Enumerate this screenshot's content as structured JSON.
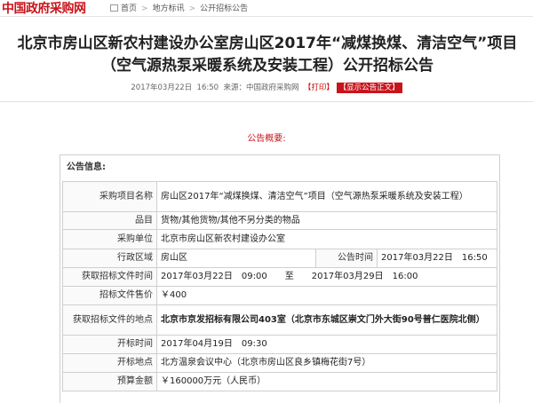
{
  "header": {
    "logo": "中国政府采购网",
    "breadcrumb": [
      "首页",
      "地方标讯",
      "公开招标公告"
    ]
  },
  "article": {
    "title": "北京市房山区新农村建设办公室房山区2017年“减煤换煤、清洁空气”项目（空气源热泵采暖系统及安装工程）公开招标公告",
    "date": "2017年03月22日",
    "time": "16:50",
    "source_label": "来源：",
    "source": "中国政府采购网",
    "print_label": "【打印】",
    "show_body_label": "【显示公告正文】"
  },
  "overview_title": "公告概要:",
  "info": {
    "heading": "公告信息:",
    "rows": [
      {
        "label": "采购项目名称",
        "value": "房山区2017年“减煤换煤、清洁空气”项目（空气源热泵采暖系统及安装工程）"
      },
      {
        "label": "品目",
        "value": "货物/其他货物/其他不另分类的物品"
      },
      {
        "label": "采购单位",
        "value": "北京市房山区新农村建设办公室"
      },
      {
        "label": "行政区域",
        "value": "房山区",
        "label2": "公告时间",
        "value2": "2017年03月22日　16:50"
      },
      {
        "label": "获取招标文件时间",
        "value": "2017年03月22日　09:00　　至　　2017年03月29日　16:00"
      },
      {
        "label": "招标文件售价",
        "value": "￥400"
      },
      {
        "label": "获取招标文件的地点",
        "value": "北京市京发招标有限公司403室（北京市东城区崇文门外大街90号普仁医院北侧）"
      },
      {
        "label": "开标时间",
        "value": "2017年04月19日　09:30"
      },
      {
        "label": "开标地点",
        "value": "北方温泉会议中心（北京市房山区良乡镇梅花街7号）"
      },
      {
        "label": "预算金额",
        "value": "￥160000万元（人民币）"
      }
    ]
  }
}
